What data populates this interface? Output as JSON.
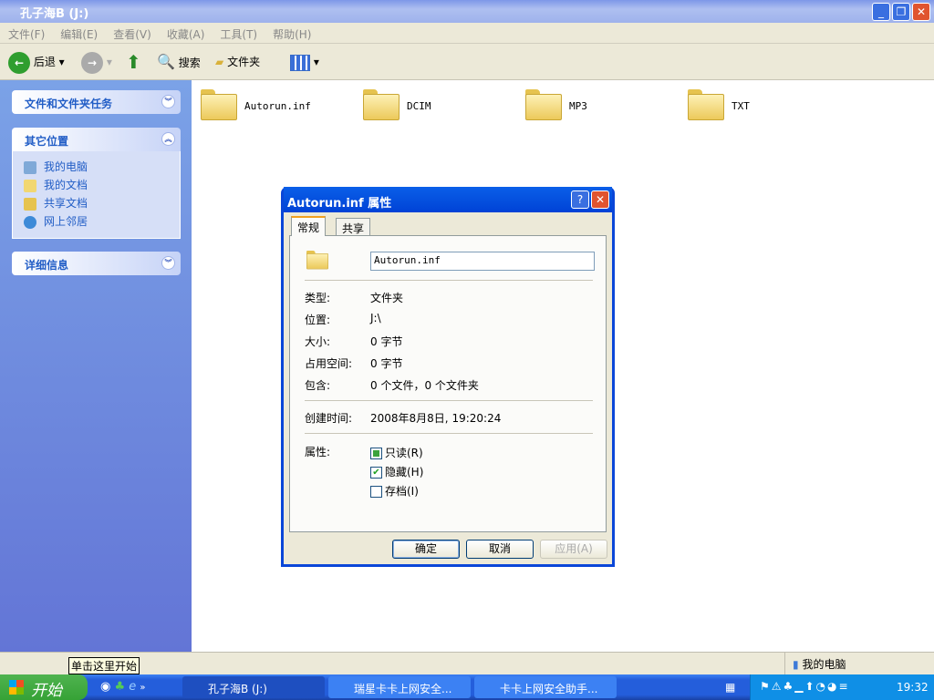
{
  "window": {
    "title": "孔子海B (J:)"
  },
  "menu": [
    "文件(F)",
    "编辑(E)",
    "查看(V)",
    "收藏(A)",
    "工具(T)",
    "帮助(H)"
  ],
  "toolbar": {
    "back": "后退",
    "search": "搜索",
    "folders": "文件夹"
  },
  "sidebar": {
    "tasks": "文件和文件夹任务",
    "other": "其它位置",
    "places": [
      "我的电脑",
      "我的文档",
      "共享文档",
      "网上邻居"
    ],
    "details": "详细信息"
  },
  "files": [
    "Autorun.inf",
    "DCIM",
    "MP3",
    "TXT"
  ],
  "dialog": {
    "title": "Autorun.inf 属性",
    "tabs": [
      "常规",
      "共享"
    ],
    "name": "Autorun.inf",
    "rows": [
      {
        "k": "类型:",
        "v": "文件夹"
      },
      {
        "k": "位置:",
        "v": "J:\\"
      },
      {
        "k": "大小:",
        "v": "0 字节"
      },
      {
        "k": "占用空间:",
        "v": "0 字节"
      },
      {
        "k": "包含:",
        "v": "0 个文件，0 个文件夹"
      }
    ],
    "created_label": "创建时间:",
    "created": "2008年8月8日, 19:20:24",
    "attr_label": "属性:",
    "attrs": [
      {
        "label": "只读(R)",
        "state": "indeterminate"
      },
      {
        "label": "隐藏(H)",
        "state": "checked"
      },
      {
        "label": "存档(I)",
        "state": "unchecked"
      }
    ],
    "ok": "确定",
    "cancel": "取消",
    "apply": "应用(A)"
  },
  "status": {
    "tooltip": "单击这里开始",
    "location": "我的电脑"
  },
  "taskbar": {
    "start": "开始",
    "tasks": [
      "孔子海B (J:)",
      "瑞星卡卡上网安全...",
      "卡卡上网安全助手..."
    ],
    "clock": "19:32"
  }
}
